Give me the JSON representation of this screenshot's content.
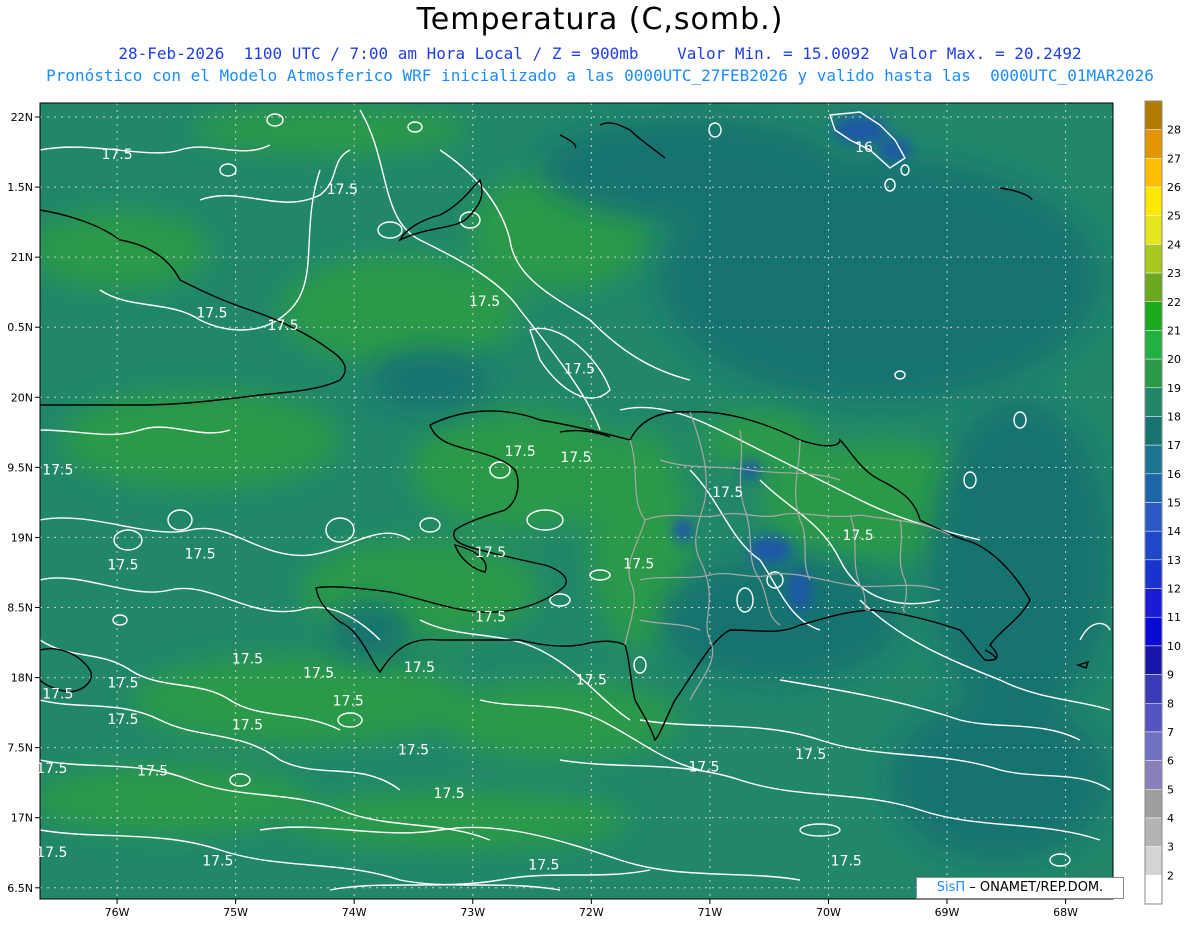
{
  "header": {
    "title": "Temperatura (C,somb.)",
    "subtitle_1": "28-Feb-2026  1100 UTC / 7:00 am Hora Local / Z = 900mb    Valor Min. = 15.0092  Valor Max. = 20.2492",
    "subtitle_2": "Pronóstico con el Modelo Atmosferico WRF inicializado a las 0000UTC_27FEB2026 y valido hasta las  0000UTC_01MAR2026"
  },
  "map": {
    "lon_range": [
      -76.65,
      -67.6
    ],
    "lat_range": [
      16.42,
      22.1
    ],
    "lat_ticks": [
      {
        "value": 22,
        "label": "22N"
      },
      {
        "value": 21.5,
        "label": "1.5N"
      },
      {
        "value": 21,
        "label": "21N"
      },
      {
        "value": 20.5,
        "label": "0.5N"
      },
      {
        "value": 20,
        "label": "20N"
      },
      {
        "value": 19.5,
        "label": "9.5N"
      },
      {
        "value": 19,
        "label": "19N"
      },
      {
        "value": 18.5,
        "label": "8.5N"
      },
      {
        "value": 18,
        "label": "18N"
      },
      {
        "value": 17.5,
        "label": "7.5N"
      },
      {
        "value": 17,
        "label": "17N"
      },
      {
        "value": 16.5,
        "label": "6.5N"
      }
    ],
    "lon_ticks": [
      {
        "value": -76,
        "label": "76W"
      },
      {
        "value": -75,
        "label": "75W"
      },
      {
        "value": -74,
        "label": "74W"
      },
      {
        "value": -73,
        "label": "73W"
      },
      {
        "value": -72,
        "label": "72W"
      },
      {
        "value": -71,
        "label": "71W"
      },
      {
        "value": -70,
        "label": "70W"
      },
      {
        "value": -69,
        "label": "69W"
      },
      {
        "value": -68,
        "label": "68W"
      }
    ],
    "contour_labels": [
      {
        "text": "17.5",
        "lon": -76.0,
        "lat": 21.7
      },
      {
        "text": "17.5",
        "lon": -74.1,
        "lat": 21.45
      },
      {
        "text": "17.5",
        "lon": -75.2,
        "lat": 20.57
      },
      {
        "text": "17.5",
        "lon": -74.6,
        "lat": 20.48
      },
      {
        "text": "17.5",
        "lon": -72.9,
        "lat": 20.65
      },
      {
        "text": "17.5",
        "lon": -72.1,
        "lat": 20.17
      },
      {
        "text": "17.5",
        "lon": -76.5,
        "lat": 19.45
      },
      {
        "text": "17.5",
        "lon": -72.6,
        "lat": 19.58
      },
      {
        "text": "17.5",
        "lon": -72.13,
        "lat": 19.54
      },
      {
        "text": "17.5",
        "lon": -70.85,
        "lat": 19.29
      },
      {
        "text": "17.5",
        "lon": -75.3,
        "lat": 18.85
      },
      {
        "text": "17.5",
        "lon": -75.95,
        "lat": 18.77
      },
      {
        "text": "17.5",
        "lon": -72.85,
        "lat": 18.86
      },
      {
        "text": "17.5",
        "lon": -71.6,
        "lat": 18.78
      },
      {
        "text": "17.5",
        "lon": -69.75,
        "lat": 18.98
      },
      {
        "text": "17.5",
        "lon": -72.85,
        "lat": 18.4
      },
      {
        "text": "17.5",
        "lon": -74.9,
        "lat": 18.1
      },
      {
        "text": "17.5",
        "lon": -74.3,
        "lat": 18.0
      },
      {
        "text": "17.5",
        "lon": -73.45,
        "lat": 18.04
      },
      {
        "text": "17.5",
        "lon": -72.0,
        "lat": 17.95
      },
      {
        "text": "17.5",
        "lon": -75.95,
        "lat": 17.93
      },
      {
        "text": "17.5",
        "lon": -76.5,
        "lat": 17.85
      },
      {
        "text": "17.5",
        "lon": -74.05,
        "lat": 17.8
      },
      {
        "text": "17.5",
        "lon": -75.95,
        "lat": 17.67
      },
      {
        "text": "17.5",
        "lon": -74.9,
        "lat": 17.63
      },
      {
        "text": "17.5",
        "lon": -73.5,
        "lat": 17.45
      },
      {
        "text": "17.5",
        "lon": -71.05,
        "lat": 17.33
      },
      {
        "text": "17.5",
        "lon": -70.15,
        "lat": 17.42
      },
      {
        "text": "17.5",
        "lon": -76.55,
        "lat": 17.32
      },
      {
        "text": "17.5",
        "lon": -75.7,
        "lat": 17.3
      },
      {
        "text": "17.5",
        "lon": -73.2,
        "lat": 17.14
      },
      {
        "text": "17.5",
        "lon": -76.55,
        "lat": 16.72
      },
      {
        "text": "17.5",
        "lon": -75.15,
        "lat": 16.66
      },
      {
        "text": "17.5",
        "lon": -72.4,
        "lat": 16.63
      },
      {
        "text": "17.5",
        "lon": -69.85,
        "lat": 16.66
      },
      {
        "text": "16",
        "lon": -69.7,
        "lat": 21.75
      }
    ],
    "colors": {
      "base": "#21866a",
      "warm": "#2a9a48",
      "cool": "#17736f",
      "cold": "#1f59a6",
      "coast": "#000000",
      "provinces": "#a8a8a8",
      "contour": "#ffffff",
      "grid": "#d0d0d0"
    }
  },
  "legend": {
    "scale": [
      {
        "value": "28",
        "color": "#b47a00"
      },
      {
        "value": "27",
        "color": "#e29500"
      },
      {
        "value": "26",
        "color": "#ffbf00"
      },
      {
        "value": "25",
        "color": "#ffe800"
      },
      {
        "value": "24",
        "color": "#e6e61e"
      },
      {
        "value": "23",
        "color": "#a8c81f"
      },
      {
        "value": "22",
        "color": "#6aa81e"
      },
      {
        "value": "21",
        "color": "#1aaa1a"
      },
      {
        "value": "20",
        "color": "#22b040"
      },
      {
        "value": "19",
        "color": "#2a9a48"
      },
      {
        "value": "18",
        "color": "#21866a"
      },
      {
        "value": "17",
        "color": "#17736f"
      },
      {
        "value": "16",
        "color": "#1a7590"
      },
      {
        "value": "15",
        "color": "#1c65a8"
      },
      {
        "value": "14",
        "color": "#2a58c4"
      },
      {
        "value": "13",
        "color": "#1f48c8"
      },
      {
        "value": "12",
        "color": "#1a32d0"
      },
      {
        "value": "11",
        "color": "#1a1ad8"
      },
      {
        "value": "10",
        "color": "#0a0ad6"
      },
      {
        "value": "9",
        "color": "#1616aa"
      },
      {
        "value": "8",
        "color": "#3b3bb8"
      },
      {
        "value": "7",
        "color": "#5555c2"
      },
      {
        "value": "6",
        "color": "#7070c2"
      },
      {
        "value": "5",
        "color": "#8a7fb8"
      },
      {
        "value": "4",
        "color": "#9e9e9e"
      },
      {
        "value": "3",
        "color": "#b4b4b4"
      },
      {
        "value": "2",
        "color": "#d4d4d4"
      },
      {
        "value": "",
        "color": "#ffffff"
      }
    ]
  },
  "credit": {
    "brand": "SisΠ",
    "text": " – ONAMET/REP.DOM."
  }
}
